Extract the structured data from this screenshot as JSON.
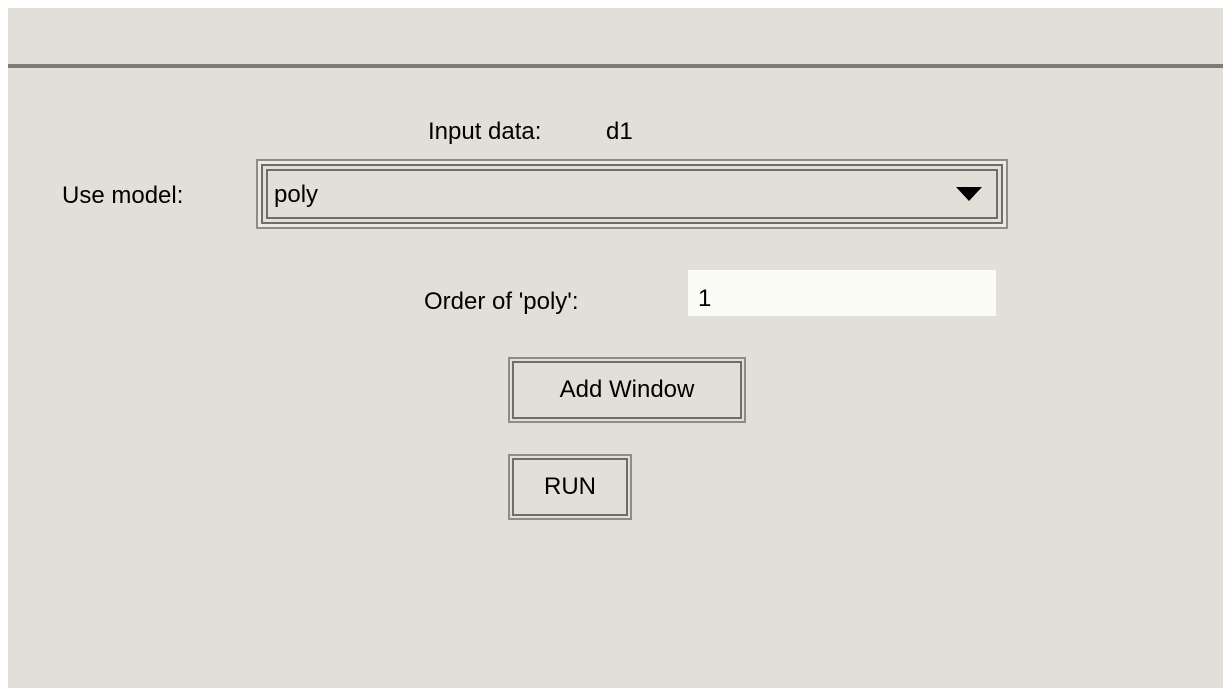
{
  "input_data": {
    "label": "Input data:",
    "value": "d1"
  },
  "model": {
    "label": "Use model:",
    "selected": "poly"
  },
  "order": {
    "label": "Order of 'poly':",
    "value": "1"
  },
  "buttons": {
    "add_window": "Add Window",
    "run": "RUN"
  },
  "colors": {
    "panel_background": "#e2ded8",
    "text_field_background": "#fbfbf6",
    "border_dark": "#6f6d69"
  },
  "icons": {
    "dropdown": "chevron-down-icon"
  }
}
